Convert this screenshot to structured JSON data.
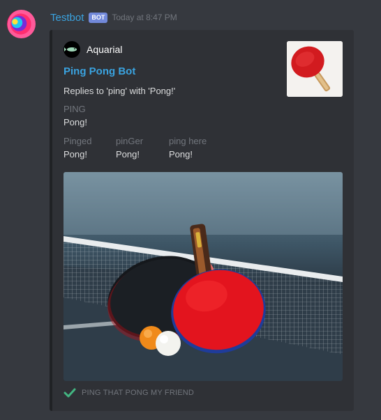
{
  "message": {
    "username": "Testbot",
    "bot_tag": "BOT",
    "timestamp": "Today at 8:47 PM"
  },
  "embed": {
    "author": "Aquarial",
    "title": "Ping Pong Bot",
    "description": "Replies to 'ping' with 'Pong!'",
    "fields": [
      {
        "name": "PING",
        "value": "Pong!"
      },
      {
        "name": "Pinged",
        "value": "Pong!"
      },
      {
        "name": "pinGer",
        "value": "Pong!"
      },
      {
        "name": "ping here",
        "value": "Pong!"
      }
    ],
    "footer": "PING THAT PONG MY FRIEND",
    "colors": {
      "link": "#3aa3e0",
      "embed_bg": "#2f3136",
      "paddle_red": "#e3141e",
      "footer_check": "#43b581"
    }
  }
}
